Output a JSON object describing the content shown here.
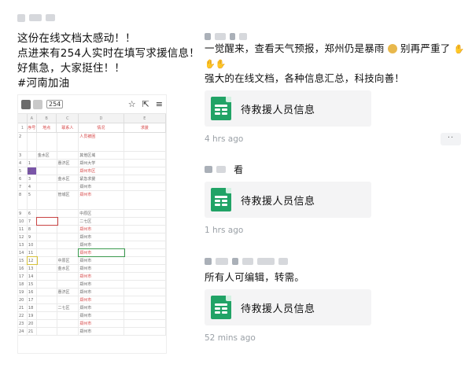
{
  "left_post": {
    "lines": [
      "这份在线文档太感动！！",
      "点进来有254人实时在填写求援信息！",
      "好焦急，大家挺住！！",
      "#河南加油"
    ],
    "sheet": {
      "viewer_count": "254",
      "col_headers": [
        "A",
        "B",
        "C",
        "D",
        "E"
      ],
      "header_cells": [
        "序号",
        "地点",
        "联系人",
        "情况",
        "求援"
      ],
      "rows": [
        {
          "n": "2",
          "a": "",
          "b": "",
          "c": "",
          "d": "人员被困"
        },
        {
          "n": "3",
          "a": "",
          "b": "金水区",
          "c": "",
          "d": "其他区域"
        },
        {
          "n": "4",
          "a": "1",
          "b": "",
          "c": "惠济区",
          "d": "郑州大学"
        },
        {
          "n": "5",
          "a": "2",
          "b": "",
          "c": "",
          "d": "郑州市区"
        },
        {
          "n": "6",
          "a": "3",
          "b": "",
          "c": "金水区",
          "d": "紧急求援"
        },
        {
          "n": "7",
          "a": "4",
          "b": "",
          "c": "",
          "d": "郑州市"
        },
        {
          "n": "8",
          "a": "5",
          "b": "",
          "c": "管城区",
          "d": "郑州市"
        },
        {
          "n": "9",
          "a": "6",
          "b": "",
          "c": "",
          "d": "中原区"
        },
        {
          "n": "10",
          "a": "7",
          "b": "",
          "c": "",
          "d": "二七区"
        },
        {
          "n": "11",
          "a": "8",
          "b": "",
          "c": "",
          "d": "郑州市"
        },
        {
          "n": "12",
          "a": "9",
          "b": "",
          "c": "",
          "d": "郑州市"
        },
        {
          "n": "13",
          "a": "10",
          "b": "",
          "c": "",
          "d": "郑州市"
        },
        {
          "n": "14",
          "a": "11",
          "b": "",
          "c": "",
          "d": "郑州市"
        },
        {
          "n": "15",
          "a": "12",
          "b": "",
          "c": "中原区",
          "d": "郑州市"
        },
        {
          "n": "16",
          "a": "13",
          "b": "",
          "c": "金水区",
          "d": "郑州市"
        },
        {
          "n": "17",
          "a": "14",
          "b": "",
          "c": "",
          "d": "郑州市"
        },
        {
          "n": "18",
          "a": "15",
          "b": "",
          "c": "",
          "d": "郑州市"
        },
        {
          "n": "19",
          "a": "16",
          "b": "",
          "c": "惠济区",
          "d": "郑州市"
        },
        {
          "n": "20",
          "a": "17",
          "b": "",
          "c": "",
          "d": "郑州市"
        },
        {
          "n": "21",
          "a": "18",
          "b": "",
          "c": "二七区",
          "d": "郑州市"
        },
        {
          "n": "22",
          "a": "19",
          "b": "",
          "c": "",
          "d": "郑州市"
        },
        {
          "n": "23",
          "a": "20",
          "b": "",
          "c": "",
          "d": "郑州市"
        },
        {
          "n": "24",
          "a": "21",
          "b": "",
          "c": "",
          "d": "郑州市"
        }
      ]
    }
  },
  "feed": [
    {
      "username": "",
      "text_lines": [
        "一觉醒来，查看天气预报，郑州仍是暴雨",
        "强大的在线文档，各种信息汇总，科技向善！"
      ],
      "text_inline_after_emoji": "别再严重了",
      "doc_title": "待救援人员信息",
      "time": "4 hrs ago",
      "more_label": "··"
    },
    {
      "username": "看",
      "doc_title": "待救援人员信息",
      "time": "1 hrs ago"
    },
    {
      "username": "",
      "text_lines": [
        "所有人可编辑，转需。"
      ],
      "doc_title": "待救援人员信息",
      "time": "52 mins ago"
    }
  ],
  "colors": {
    "doc_icon": "#21a366",
    "card_bg": "#f4f4f5",
    "time_text": "#9aa0a6"
  },
  "icons": {
    "doc": "spreadsheet-icon",
    "star": "star-icon",
    "share": "share-icon",
    "menu": "menu-icon"
  }
}
